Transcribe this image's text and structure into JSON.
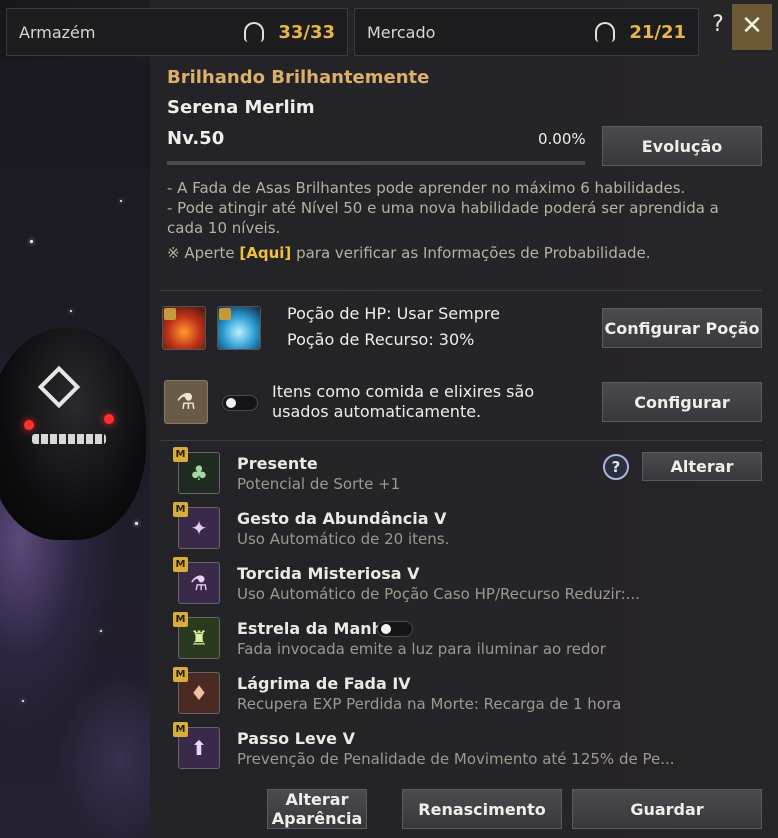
{
  "topbar": {
    "storage_label": "Armazém",
    "storage_count": "33/33",
    "market_label": "Mercado",
    "market_count": "21/21",
    "help_label": "?",
    "close_label": "✕"
  },
  "fairy": {
    "title": "Brilhando Brilhantemente",
    "name": "Serena Merlim",
    "level": "Nv.50",
    "progress_text": "0.00%",
    "progress_value": 0,
    "evolve_button": "Evolução"
  },
  "info": {
    "line1": "- A Fada de Asas Brilhantes pode aprender no máximo 6 habilidades.",
    "line2": "- Pode atingir até Nível 50 e uma nova habilidade poderá ser aprendida a",
    "line3": "cada 10 níveis.",
    "probability_prefix": "※ Aperte ",
    "probability_link": "[Aqui]",
    "probability_suffix": " para verificar as Informações de Probabilidade."
  },
  "potion": {
    "hp_text": "Poção de HP: Usar Sempre",
    "resource_text": "Poção de Recurso: 30%",
    "configure_button": "Configurar Poção"
  },
  "auto_items": {
    "text": "Itens como comida e elixires são usados automaticamente.",
    "toggle_on": false,
    "configure_button": "Configurar"
  },
  "skills": {
    "change_button": "Alterar",
    "help_label": "?",
    "badge_label": "M",
    "items": [
      {
        "name": "Presente",
        "desc": "Potencial de Sorte +1",
        "icon": "clover-icon"
      },
      {
        "name": "Gesto da Abundância V",
        "desc": "Uso Automático de 20 itens.",
        "icon": "fairy-icon"
      },
      {
        "name": "Torcida Misteriosa V",
        "desc": "Uso Automático de Poção Caso HP/Recurso Reduzir:...",
        "icon": "potion-flask-icon"
      },
      {
        "name": "Estrela da Manhã",
        "desc": "Fada invocada emite a luz para iluminar ao redor",
        "icon": "lantern-icon",
        "toggle_on": false
      },
      {
        "name": "Lágrima de Fada IV",
        "desc": "Recupera EXP Perdida na Morte: Recarga de 1 hora",
        "icon": "tear-icon"
      },
      {
        "name": "Passo Leve V",
        "desc": "Prevenção de Penalidade de Movimento até 125% de Pe...",
        "icon": "bag-icon"
      }
    ]
  },
  "bottom": {
    "appearance_line1": "Alterar",
    "appearance_line2": "Aparência",
    "rebirth_button": "Renascimento",
    "store_button": "Guardar"
  }
}
